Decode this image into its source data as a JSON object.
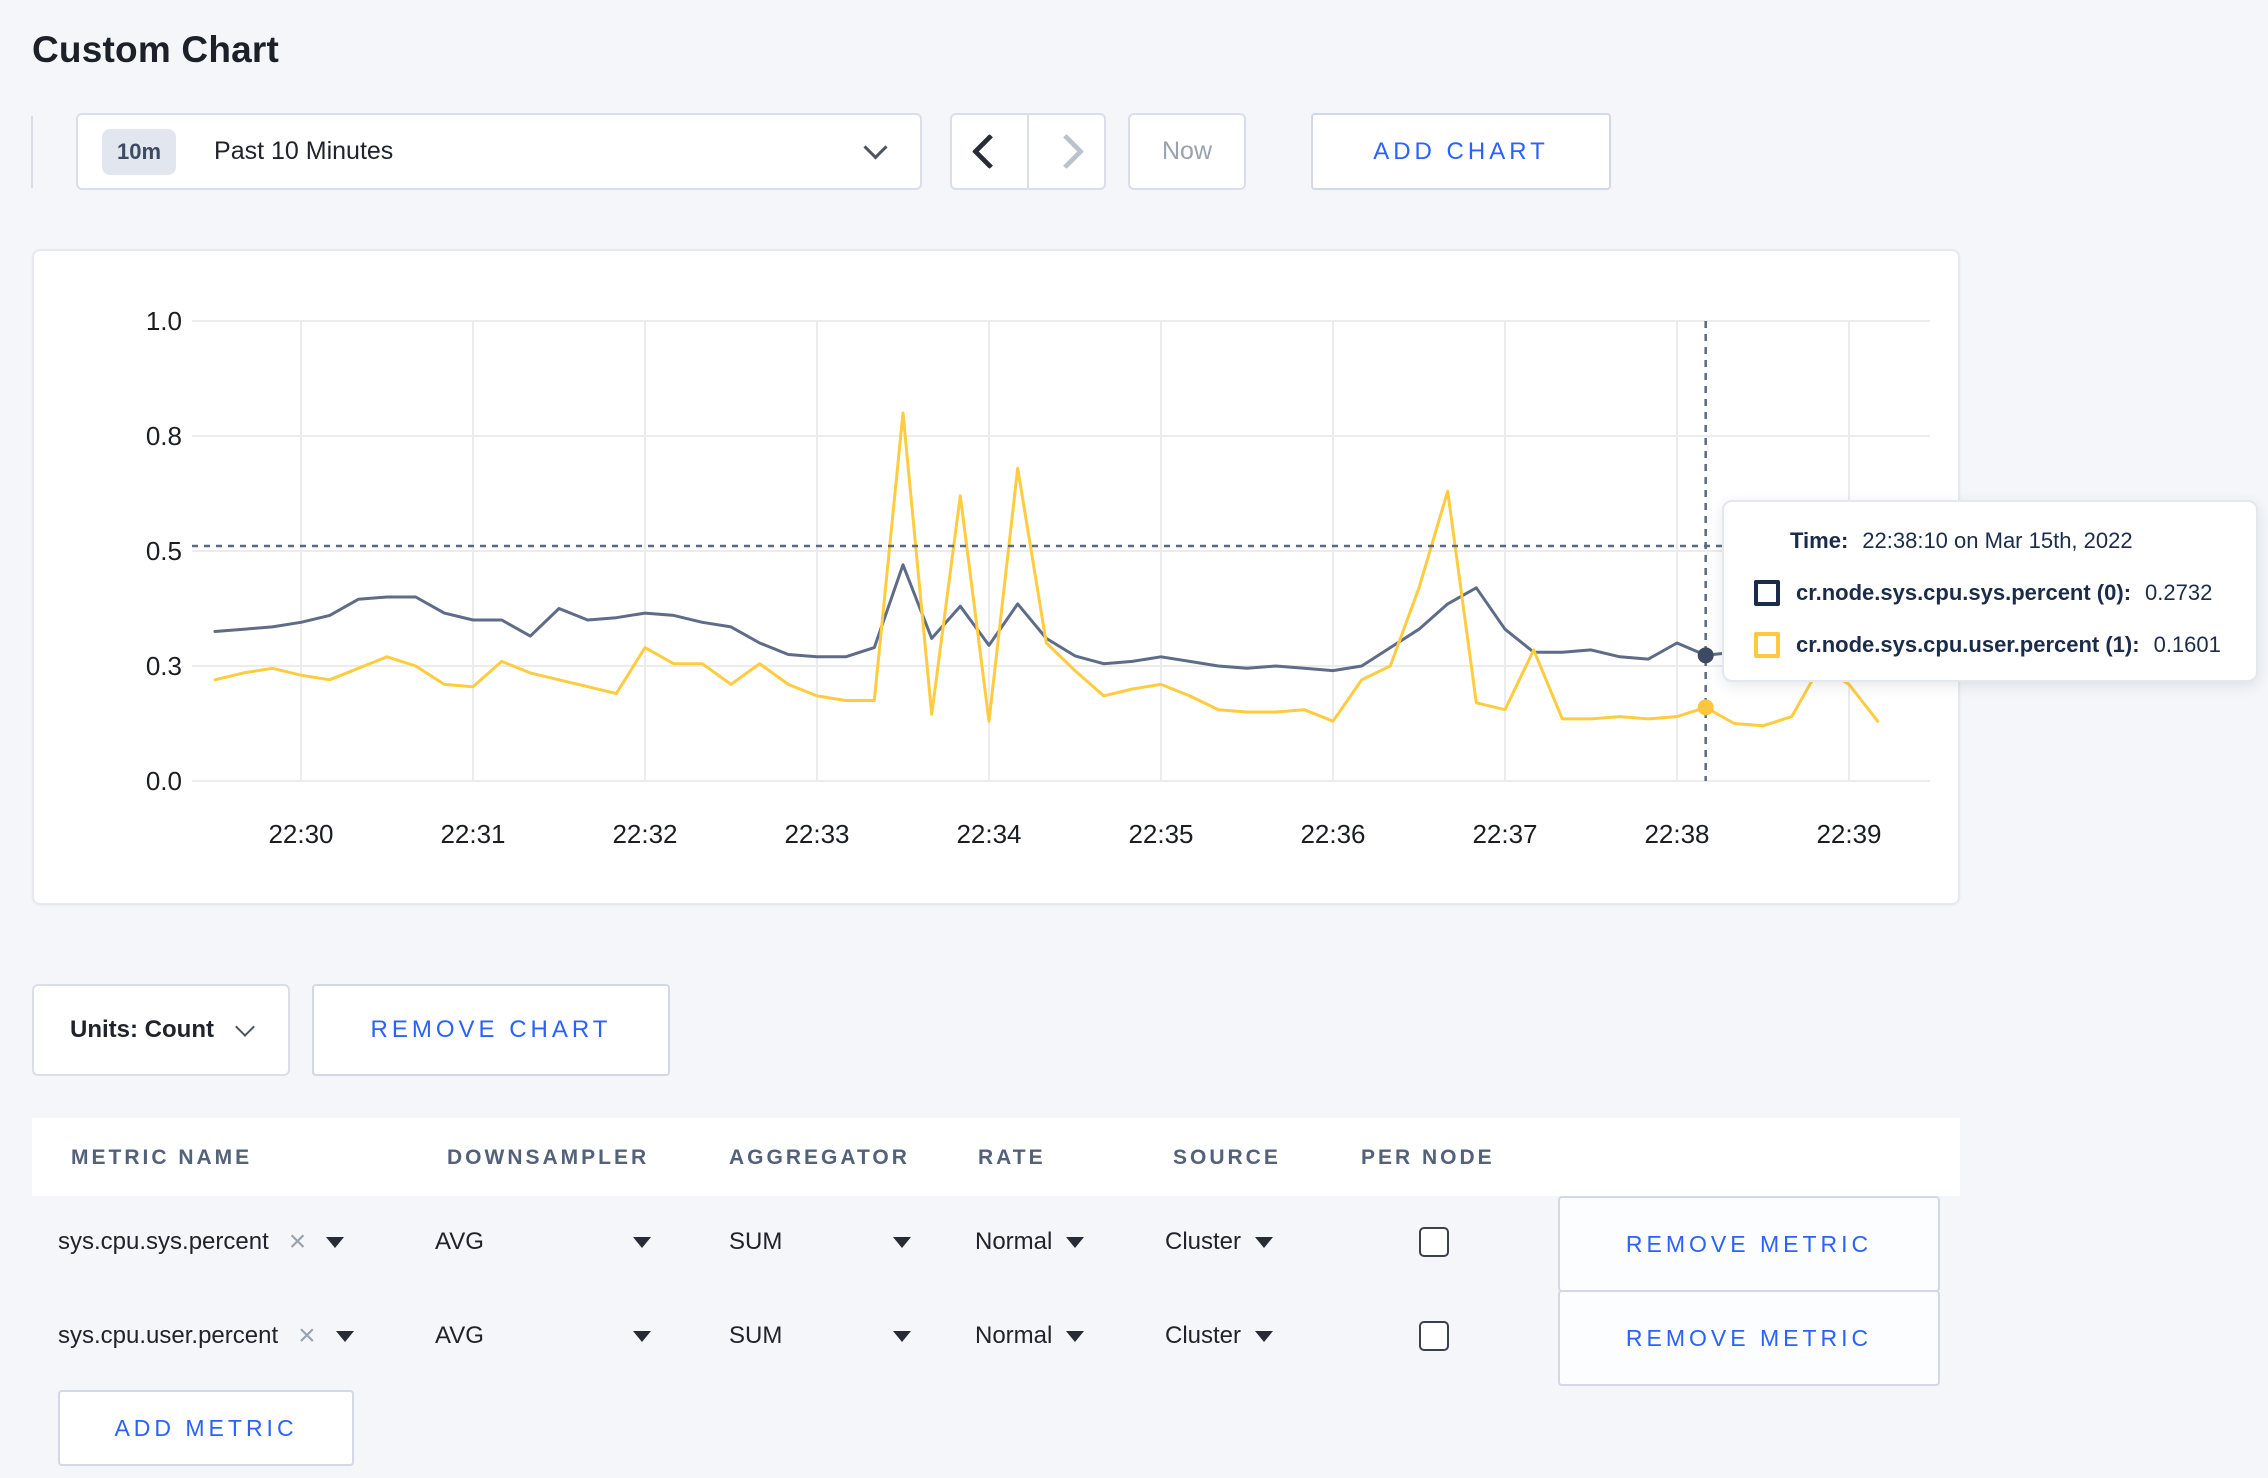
{
  "page_title": "Custom Chart",
  "toolbar": {
    "range_badge": "10m",
    "range_label": "Past 10 Minutes",
    "now_label": "Now",
    "add_chart_label": "ADD CHART"
  },
  "chart_data": {
    "type": "line",
    "title": "",
    "xlabel": "",
    "ylabel": "",
    "grid": true,
    "legend_position": "hover-tooltip",
    "x_axis": {
      "start_minutes": 29.5,
      "step_seconds": 10,
      "first_tick_minutes": 30,
      "minutes_per_tick": 1,
      "ticks": [
        "22:30",
        "22:31",
        "22:32",
        "22:33",
        "22:34",
        "22:35",
        "22:36",
        "22:37",
        "22:38",
        "22:39"
      ]
    },
    "y_axis": {
      "lim": [
        0,
        1
      ],
      "ticks": [
        {
          "value": 0,
          "label": "0.0"
        },
        {
          "value": 0.25,
          "label": "0.3"
        },
        {
          "value": 0.5,
          "label": "0.5"
        },
        {
          "value": 0.75,
          "label": "0.8"
        },
        {
          "value": 1,
          "label": "1.0"
        }
      ]
    },
    "series": [
      {
        "name": "cr.node.sys.cpu.sys.percent",
        "color": "#5e6c88",
        "values": [
          0.325,
          0.33,
          0.335,
          0.345,
          0.36,
          0.395,
          0.4,
          0.4,
          0.365,
          0.35,
          0.35,
          0.315,
          0.375,
          0.35,
          0.355,
          0.365,
          0.36,
          0.345,
          0.335,
          0.3,
          0.275,
          0.27,
          0.27,
          0.29,
          0.47,
          0.31,
          0.38,
          0.295,
          0.385,
          0.31,
          0.272,
          0.255,
          0.26,
          0.27,
          0.26,
          0.25,
          0.245,
          0.25,
          0.245,
          0.24,
          0.25,
          0.29,
          0.33,
          0.385,
          0.42,
          0.33,
          0.28,
          0.28,
          0.285,
          0.27,
          0.265,
          0.3,
          0.2732,
          0.28,
          0.28,
          0.285,
          0.29,
          0.285,
          0.285
        ]
      },
      {
        "name": "cr.node.sys.cpu.user.percent",
        "color": "#ffcc3f",
        "values": [
          0.22,
          0.235,
          0.245,
          0.23,
          0.22,
          0.245,
          0.27,
          0.25,
          0.21,
          0.205,
          0.26,
          0.235,
          0.22,
          0.205,
          0.19,
          0.29,
          0.255,
          0.255,
          0.21,
          0.255,
          0.21,
          0.185,
          0.175,
          0.175,
          0.8,
          0.145,
          0.62,
          0.13,
          0.68,
          0.3,
          0.24,
          0.185,
          0.2,
          0.21,
          0.185,
          0.155,
          0.15,
          0.15,
          0.155,
          0.13,
          0.22,
          0.25,
          0.42,
          0.63,
          0.17,
          0.155,
          0.285,
          0.135,
          0.135,
          0.14,
          0.135,
          0.14,
          0.1601,
          0.125,
          0.12,
          0.14,
          0.25,
          0.21,
          0.13
        ]
      }
    ],
    "crosshair": {
      "time": "22:38:10",
      "x_minutes": 38.1667,
      "y_value": 0.511,
      "points": [
        {
          "value": 0.2732,
          "color": "#3d4a64"
        },
        {
          "value": 0.1601,
          "color": "#ffc53e"
        }
      ]
    }
  },
  "tooltip": {
    "time_label": "Time:",
    "time_value": "22:38:10 on Mar 15th, 2022",
    "entries": [
      {
        "label": "cr.node.sys.cpu.sys.percent (0):",
        "value": "0.2732",
        "color": "#1c2b49"
      },
      {
        "label": "cr.node.sys.cpu.user.percent (1):",
        "value": "0.1601",
        "color": "#ffc93e"
      }
    ]
  },
  "units": {
    "label": "Units: Count"
  },
  "remove_chart_label": "REMOVE CHART",
  "table": {
    "headers": {
      "metric": "METRIC NAME",
      "downsampler": "DOWNSAMPLER",
      "aggregator": "AGGREGATOR",
      "rate": "RATE",
      "source": "SOURCE",
      "per_node": "PER NODE"
    },
    "clear_icon": "×",
    "rows": [
      {
        "metric": "sys.cpu.sys.percent",
        "downsampler": "AVG",
        "aggregator": "SUM",
        "rate": "Normal",
        "source": "Cluster",
        "per_node_checked": false,
        "remove_label": "REMOVE METRIC"
      },
      {
        "metric": "sys.cpu.user.percent",
        "downsampler": "AVG",
        "aggregator": "SUM",
        "rate": "Normal",
        "source": "Cluster",
        "per_node_checked": false,
        "remove_label": "REMOVE METRIC"
      }
    ],
    "add_metric_label": "ADD METRIC"
  },
  "colors": {
    "accent_blue": "#2962ff",
    "page_background": "#f4f6f9",
    "series_sys": "#5e6c88",
    "series_user": "#ffcc3f"
  }
}
